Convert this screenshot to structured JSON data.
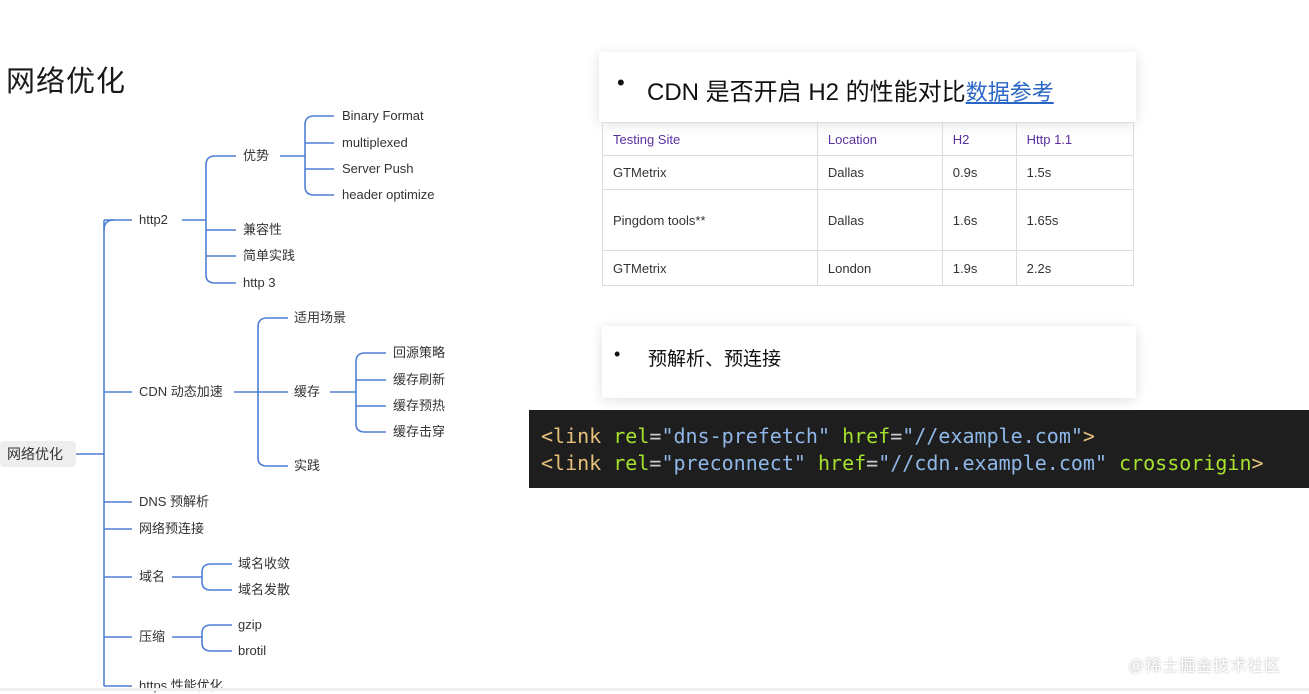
{
  "page_title": "网络优化",
  "mindmap": {
    "root": "网络优化",
    "http2": {
      "label": "http2",
      "advantage": "优势",
      "advantage_items": [
        "Binary Format",
        "multiplexed",
        "Server Push",
        "header optimize"
      ],
      "compat": "兼容性",
      "practice": "简单实践",
      "http3": "http 3"
    },
    "cdn": {
      "label": "CDN 动态加速",
      "scenario": "适用场景",
      "cache": "缓存",
      "cache_items": [
        "回源策略",
        "缓存刷新",
        "缓存预热",
        "缓存击穿"
      ],
      "practice": "实践"
    },
    "dns": "DNS 预解析",
    "preconnect": "网络预连接",
    "domain": {
      "label": "域名",
      "items": [
        "域名收敛",
        "域名发散"
      ]
    },
    "compress": {
      "label": "压缩",
      "items": [
        "gzip",
        "brotil"
      ]
    },
    "https": "https 性能优化"
  },
  "card1": {
    "bullet": "•",
    "heading": "CDN 是否开启 H2 的性能对比",
    "link": "数据参考"
  },
  "table": {
    "headers": [
      "Testing Site",
      "Location",
      "H2",
      "Http 1.1"
    ],
    "rows": [
      [
        "GTMetrix",
        "Dallas",
        "0.9s",
        "1.5s"
      ],
      [
        "Pingdom tools**",
        "Dallas",
        "1.6s",
        "1.65s"
      ],
      [
        "GTMetrix",
        "London",
        "1.9s",
        "2.2s"
      ]
    ]
  },
  "card2": {
    "bullet": "•",
    "heading": "预解析、预连接"
  },
  "code": {
    "line1": {
      "tag": "<link",
      "attr1": "rel",
      "val1": "\"dns-prefetch\"",
      "attr2": "href",
      "val2": "\"//example.com\"",
      "end": ">"
    },
    "line2": {
      "tag": "<link",
      "attr1": "rel",
      "val1": "\"preconnect\"",
      "attr2": "href",
      "val2": "\"//cdn.example.com\"",
      "attr3": "crossorigin",
      "end": ">"
    }
  },
  "watermark": "@稀土掘金技术社区",
  "colors": {
    "mindmap_line": "#4f7fd6",
    "table_header_text": "#5b2fa0",
    "link": "#2a66c5",
    "code_bg": "#1e1e1e"
  }
}
